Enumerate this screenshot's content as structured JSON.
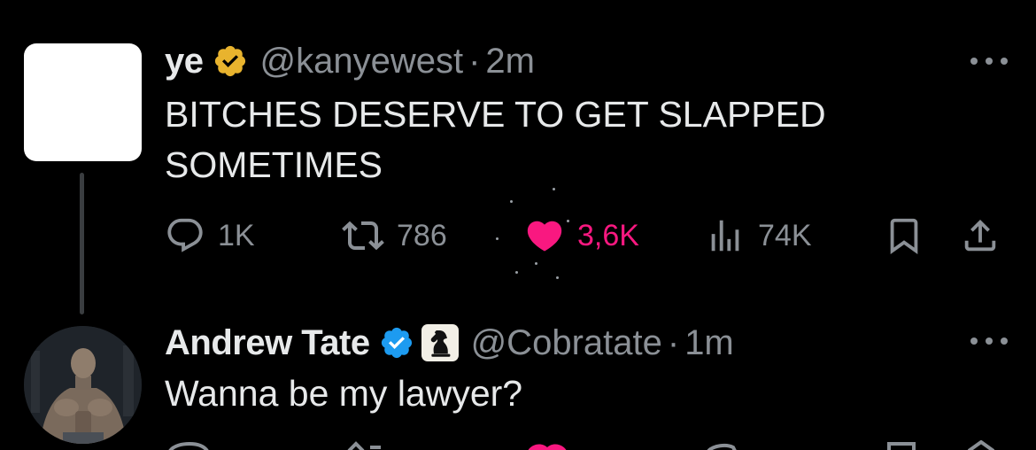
{
  "tweets": [
    {
      "display_name": "ye",
      "verified_badge": "gold-verified-badge",
      "handle": "@kanyewest",
      "separator": "·",
      "time": "2m",
      "text": "BITCHES DESERVE TO GET SLAPPED SOMETIMES",
      "stats": {
        "replies": "1K",
        "reposts": "786",
        "likes": "3,6K",
        "views": "74K"
      },
      "liked": true
    },
    {
      "display_name": "Andrew Tate",
      "verified_badge": "blue-verified-badge",
      "affiliate_badge": "chess-knight-icon",
      "handle": "@Cobratate",
      "separator": "·",
      "time": "1m",
      "text": "Wanna be my lawyer?"
    }
  ],
  "colors": {
    "background": "#000000",
    "text": "#e7e9ea",
    "secondary": "#8b9096",
    "like": "#f91880",
    "verified_gold": "#e8b32e",
    "verified_blue": "#1d9bf0"
  },
  "icons": {
    "reply": "speech-bubble-icon",
    "repost": "repost-arrows-icon",
    "like": "heart-icon",
    "views": "bar-chart-icon",
    "bookmark": "bookmark-icon",
    "share": "share-upload-icon",
    "more": "more-dots-icon"
  }
}
